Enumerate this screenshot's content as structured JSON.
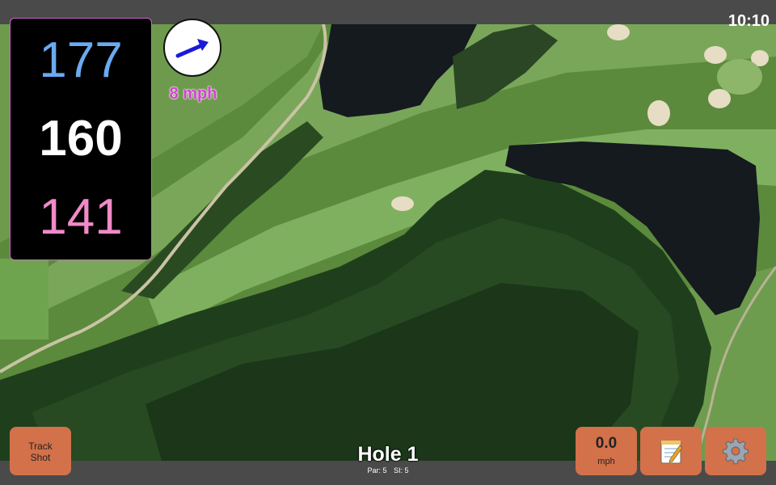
{
  "status": {
    "time": "10:10"
  },
  "distances": {
    "back": "177",
    "middle": "160",
    "front": "141",
    "colors": {
      "back": "#6aaaf0",
      "middle": "#ffffff",
      "front": "#f08ac8"
    }
  },
  "wind": {
    "speed": "8 mph",
    "arrow_icon": "wind-direction-arrow-icon",
    "arrow_color": "#1a1ad8"
  },
  "hole": {
    "title": "Hole 1",
    "par": "Par: 5",
    "si": "SI: 5"
  },
  "buttons": {
    "track_shot": {
      "line1": "Track",
      "line2": "Shot"
    },
    "speed": {
      "value": "0.0",
      "unit": "mph"
    },
    "notes_icon": "notepad-icon",
    "settings_icon": "gear-icon",
    "color": "#d2714a"
  },
  "map": {
    "type": "satellite-view"
  }
}
